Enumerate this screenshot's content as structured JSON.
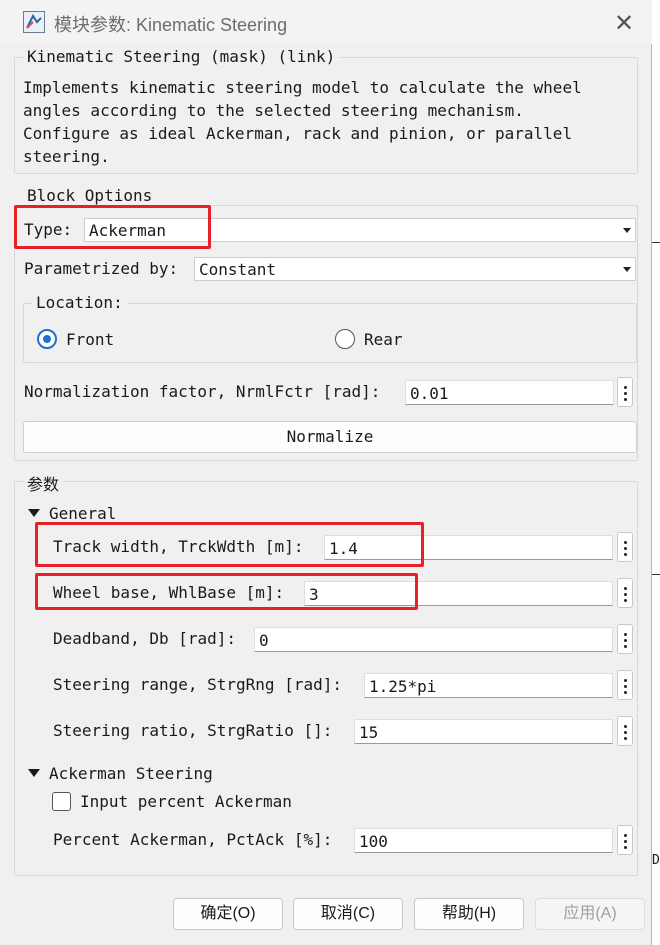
{
  "window": {
    "title": "模块参数: Kinematic Steering"
  },
  "header": {
    "block_name": "Kinematic Steering (mask) (link)",
    "description": "Implements kinematic steering model to calculate the wheel\nangles according to the selected steering mechanism.\nConfigure as ideal Ackerman, rack and pinion, or parallel\nsteering."
  },
  "block_options": {
    "title": "Block Options",
    "type_label": "Type:",
    "type_value": "Ackerman",
    "param_label": "Parametrized by:",
    "param_value": "Constant",
    "location": {
      "title": "Location:",
      "front_label": "Front",
      "front_selected": true,
      "rear_label": "Rear",
      "rear_selected": false
    },
    "norm_label": "Normalization factor, NrmlFctr [rad]:",
    "norm_value": "0.01",
    "normalize_label": "Normalize"
  },
  "parameters": {
    "title": "参数",
    "general": {
      "title": "General",
      "fields": [
        {
          "label": "Track width, TrckWdth [m]:",
          "value": "1.4"
        },
        {
          "label": "Wheel base, WhlBase [m]:",
          "value": "3"
        },
        {
          "label": "Deadband, Db [rad]:",
          "value": "0"
        },
        {
          "label": "Steering range, StrgRng [rad]:",
          "value": "1.25*pi"
        },
        {
          "label": "Steering ratio, StrgRatio []:",
          "value": "15"
        }
      ]
    },
    "ackerman": {
      "title": "Ackerman Steering",
      "input_percent_label": "Input percent Ackerman",
      "input_percent_checked": false,
      "pct_label": "Percent Ackerman, PctAck [%]:",
      "pct_value": "100"
    }
  },
  "footer": {
    "ok": "确定(O)",
    "cancel": "取消(C)",
    "help": "帮助(H)",
    "apply": "应用(A)"
  },
  "background_fragments": {
    "right_letter": "D"
  },
  "colors": {
    "highlight": "#e8202a",
    "radio_accent": "#1e6fd0",
    "dialog_bg": "#f0f0f0"
  }
}
